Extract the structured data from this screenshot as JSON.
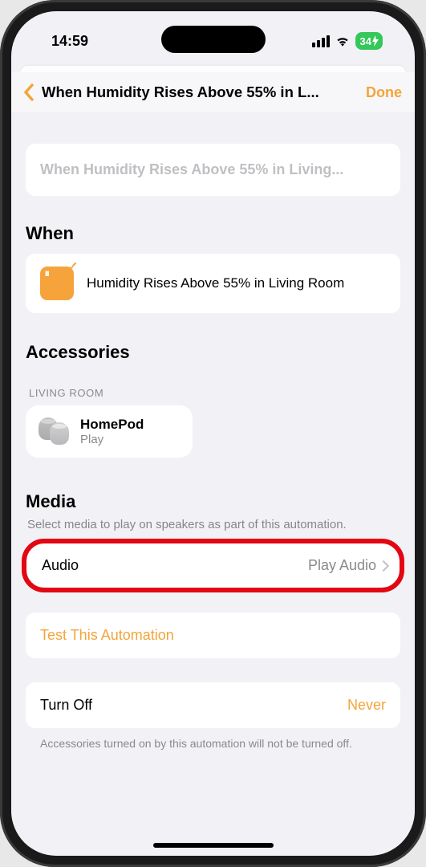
{
  "status": {
    "time": "14:59",
    "battery": "34"
  },
  "nav": {
    "title": "When Humidity Rises Above 55% in L...",
    "done": "Done"
  },
  "name_field": {
    "placeholder": "When Humidity Rises Above 55% in Living..."
  },
  "when": {
    "heading": "When",
    "condition": "Humidity Rises Above 55% in Living Room"
  },
  "accessories": {
    "heading": "Accessories",
    "group": "LIVING ROOM",
    "item": {
      "name": "HomePod",
      "state": "Play"
    }
  },
  "media": {
    "heading": "Media",
    "description": "Select media to play on speakers as part of this automation.",
    "label": "Audio",
    "value": "Play Audio"
  },
  "test": {
    "label": "Test This Automation"
  },
  "turnoff": {
    "label": "Turn Off",
    "value": "Never",
    "footnote": "Accessories turned on by this automation will not be turned off."
  }
}
